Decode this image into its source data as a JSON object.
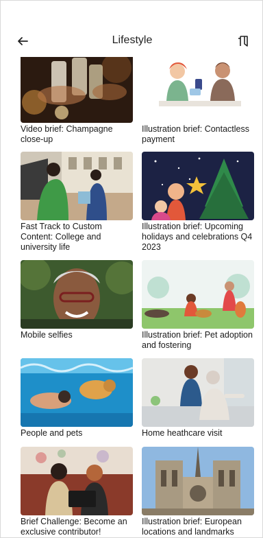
{
  "header": {
    "title": "Lifestyle",
    "back_icon": "arrow-left-icon",
    "bookmark_icon": "bookmark-icon"
  },
  "cards": [
    {
      "label": "Video brief: Champagne close-up"
    },
    {
      "label": "Illustration brief: Contactless payment"
    },
    {
      "label": "Fast Track to Custom Content: College and university life"
    },
    {
      "label": "Illustration brief: Upcoming holidays and celebrations Q4 2023"
    },
    {
      "label": "Mobile selfies"
    },
    {
      "label": "Illustration brief: Pet adoption and fostering"
    },
    {
      "label": "People and pets"
    },
    {
      "label": "Home heathcare visit"
    },
    {
      "label": "Brief Challenge: Become an exclusive contributor!"
    },
    {
      "label": "Illustration brief: European locations and landmarks"
    }
  ]
}
